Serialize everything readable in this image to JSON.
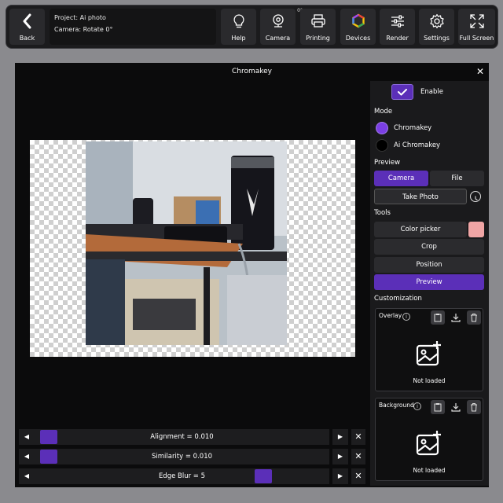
{
  "toolbar": {
    "back_label": "Back",
    "project_text": "Project: Ai photo",
    "camera_text": "Camera: Rotate 0°",
    "buttons": [
      {
        "label": "Help",
        "icon": "lightbulb-icon"
      },
      {
        "label": "Camera",
        "icon": "webcam-icon",
        "badge": "0°"
      },
      {
        "label": "Printing",
        "icon": "printer-icon"
      },
      {
        "label": "Devices",
        "icon": "devices-icon"
      },
      {
        "label": "Render",
        "icon": "sliders-icon"
      },
      {
        "label": "Settings",
        "icon": "gear-icon"
      },
      {
        "label": "Full Screen",
        "icon": "fullscreen-icon"
      }
    ]
  },
  "dialog": {
    "title": "Chromakey",
    "close_icon": "close-icon"
  },
  "sliders": [
    {
      "label": "Alignment = 0.010",
      "value_fraction": 0.01
    },
    {
      "label": "Similarity = 0.010",
      "value_fraction": 0.01
    },
    {
      "label": "Edge Blur = 5",
      "value_fraction": 0.8
    }
  ],
  "panel": {
    "enable_label": "Enable",
    "enable_checked": true,
    "mode_heading": "Mode",
    "modes": [
      {
        "label": "Chromakey",
        "selected": true
      },
      {
        "label": "Ai Chromakey",
        "selected": false
      }
    ],
    "preview_heading": "Preview",
    "preview_tabs": [
      {
        "label": "Camera",
        "active": true
      },
      {
        "label": "File",
        "active": false
      }
    ],
    "take_photo_label": "Take Photo",
    "tools_heading": "Tools",
    "color_picker_label": "Color picker",
    "picked_color": "#f0a5a5",
    "crop_label": "Crop",
    "position_label": "Position",
    "preview_label": "Preview",
    "customization_heading": "Customization",
    "overlay": {
      "title": "Overlay",
      "status": "Not loaded"
    },
    "background": {
      "title": "Background",
      "status": "Not loaded"
    }
  },
  "colors": {
    "accent": "#5b2fb8",
    "radio_selected": "#7b3fe4",
    "panel_bg": "#1a1a1c"
  }
}
